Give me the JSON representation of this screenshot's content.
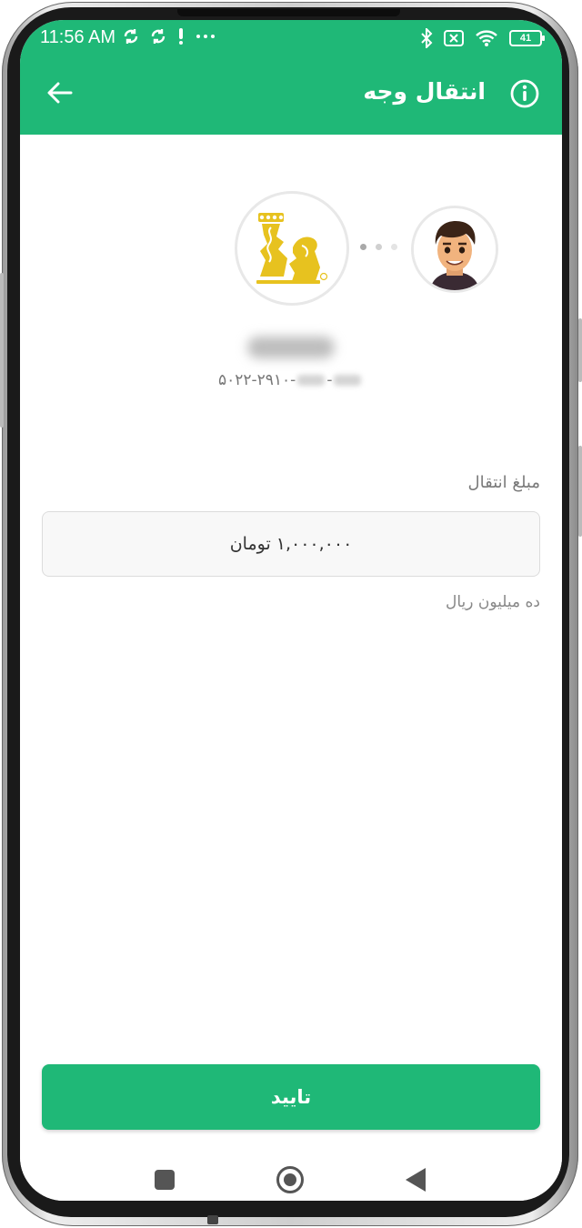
{
  "status_bar": {
    "time": "11:56 AM",
    "battery": "41"
  },
  "app_bar": {
    "title": "انتقال وجه"
  },
  "transfer": {
    "account_prefix": "۵۰۲۲-۲۹۱۰-",
    "account_suffix": "-"
  },
  "form": {
    "amount_label": "مبلغ انتقال",
    "amount_value": "۱,۰۰۰,۰۰۰ تومان",
    "amount_in_words": "ده میلیون ریال"
  },
  "actions": {
    "confirm_label": "تایید"
  },
  "colors": {
    "brand_green": "#1fb877",
    "bank_gold": "#e7c21f"
  }
}
